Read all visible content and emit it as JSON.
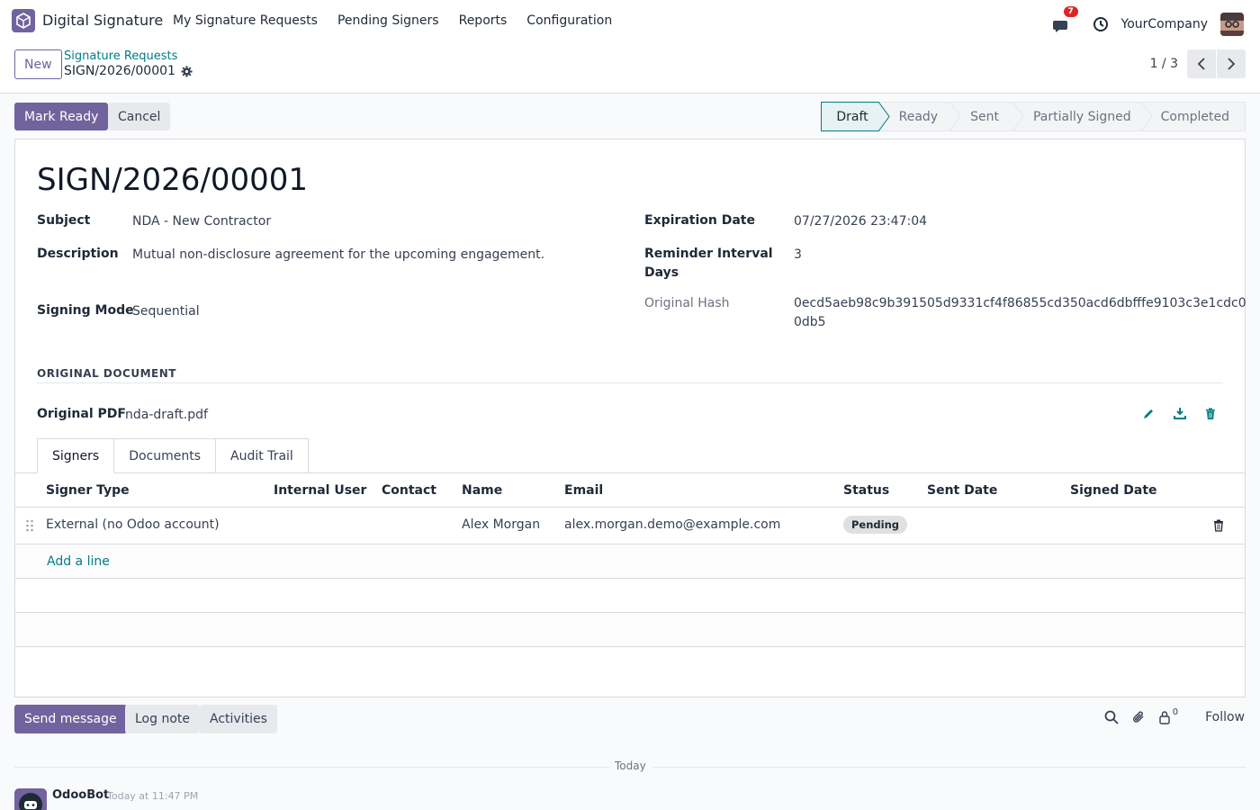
{
  "navbar": {
    "app_name": "Digital Signature",
    "menu": [
      "My Signature Requests",
      "Pending Signers",
      "Reports",
      "Configuration"
    ],
    "chat_badge": "7",
    "company": "YourCompany"
  },
  "control_panel": {
    "new_label": "New",
    "breadcrumb_parent": "Signature Requests",
    "breadcrumb_current": "SIGN/2026/00001",
    "pager": "1 / 3"
  },
  "actions": {
    "mark_ready": "Mark Ready",
    "cancel": "Cancel"
  },
  "stages": {
    "items": [
      "Draft",
      "Ready",
      "Sent",
      "Partially Signed",
      "Completed"
    ],
    "active": "Draft"
  },
  "form": {
    "title": "SIGN/2026/00001",
    "subject_label": "Subject",
    "subject": "NDA - New Contractor",
    "description_label": "Description",
    "description": "Mutual non-disclosure agreement for the upcoming engagement.",
    "signing_mode_label": "Signing Mode",
    "signing_mode": "Sequential",
    "expiration_label": "Expiration Date",
    "expiration": "07/27/2026 23:47:04",
    "reminder_label_line1": "Reminder Interval",
    "reminder_label_line2": "Days",
    "reminder": "3",
    "hash_label": "Original Hash",
    "hash_line1": "0ecd5aeb98c9b391505d9331cf4f86855cd350acd6dbfffe9103c3e1cdc0",
    "hash_line2": "0db5",
    "section_title": "ORIGINAL DOCUMENT",
    "pdf_label": "Original PDF",
    "pdf_file": "nda-draft.pdf"
  },
  "tabs": [
    "Signers",
    "Documents",
    "Audit Trail"
  ],
  "signers_table": {
    "columns": [
      "Signer Type",
      "Internal User",
      "Contact",
      "Name",
      "Email",
      "Status",
      "Sent Date",
      "Signed Date"
    ],
    "rows": [
      {
        "signer_type": "External (no Odoo account)",
        "internal_user": "",
        "contact": "",
        "name": "Alex Morgan",
        "email": "alex.morgan.demo@example.com",
        "status": "Pending",
        "sent_date": "",
        "signed_date": ""
      }
    ],
    "add_line": "Add a line"
  },
  "chatter": {
    "send_message": "Send message",
    "log_note": "Log note",
    "activities": "Activities",
    "followers_count": "0",
    "follow": "Follow",
    "date_separator": "Today",
    "author": "OdooBot",
    "time": "Today at 11:47 PM"
  },
  "colors": {
    "brand": "#71639e",
    "link": "#017e84",
    "badge": "#dc2626"
  }
}
